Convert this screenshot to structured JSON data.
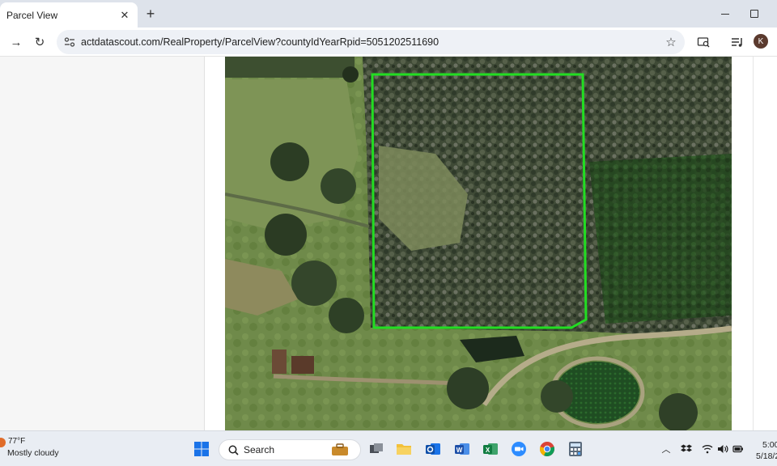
{
  "browser": {
    "tab": {
      "title": "Parcel View",
      "close_glyph": "✕"
    },
    "new_tab_glyph": "+",
    "nav": {
      "back_glyph": "→",
      "reload_glyph": "↻"
    },
    "url": "actdatascout.com/RealProperty/ParcelView?countyIdYearRpid=5051202511690",
    "star_glyph": "☆",
    "profile_initial": "K"
  },
  "map": {
    "description_icon": "aerial-map",
    "parcel_outline_color": "#22dd22"
  },
  "taskbar": {
    "weather": {
      "temp": "77°F",
      "desc": "Mostly cloudy"
    },
    "search": {
      "label": "Search"
    },
    "apps": [
      "windows-start-icon",
      "file-explorer-icon",
      "outlook-icon",
      "word-icon",
      "excel-icon",
      "zoom-icon",
      "chrome-icon",
      "calculator-icon"
    ],
    "tray": {
      "chevron_glyph": "︿"
    },
    "clock": {
      "time": "5:00",
      "date": "5/18/2"
    }
  },
  "colors": {
    "accent": "#0b57d0",
    "tabstrip": "#dee3eb",
    "taskbar": "#e9edf3"
  }
}
